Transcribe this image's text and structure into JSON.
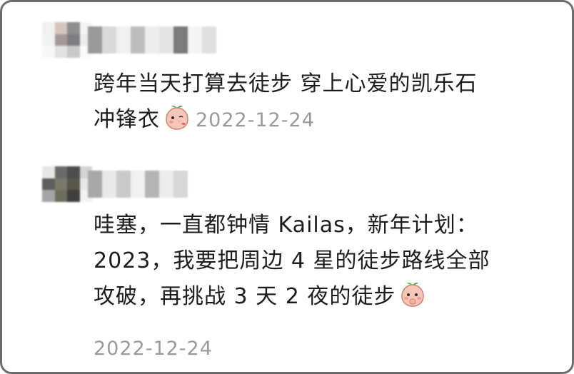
{
  "comments": [
    {
      "text_line1": "跨年当天打算去徒步 穿上心爱的凯乐石",
      "text_line2": "冲锋衣",
      "emoji": "peach-kiss-emoji",
      "timestamp": "2022-12-24"
    },
    {
      "text_line1": "哇塞，一直都钟情 Kailas，新年计划：",
      "text_line2": "2023，我要把周边 4 星的徒步路线全部",
      "text_line3": "攻破，再挑战 3 天 2 夜的徒步",
      "emoji": "peach-shy-emoji",
      "timestamp": "2022-12-24"
    }
  ],
  "colors": {
    "text": "#1c1c1c",
    "timestamp": "#9a9a9a",
    "border": "#6d6d6d"
  }
}
